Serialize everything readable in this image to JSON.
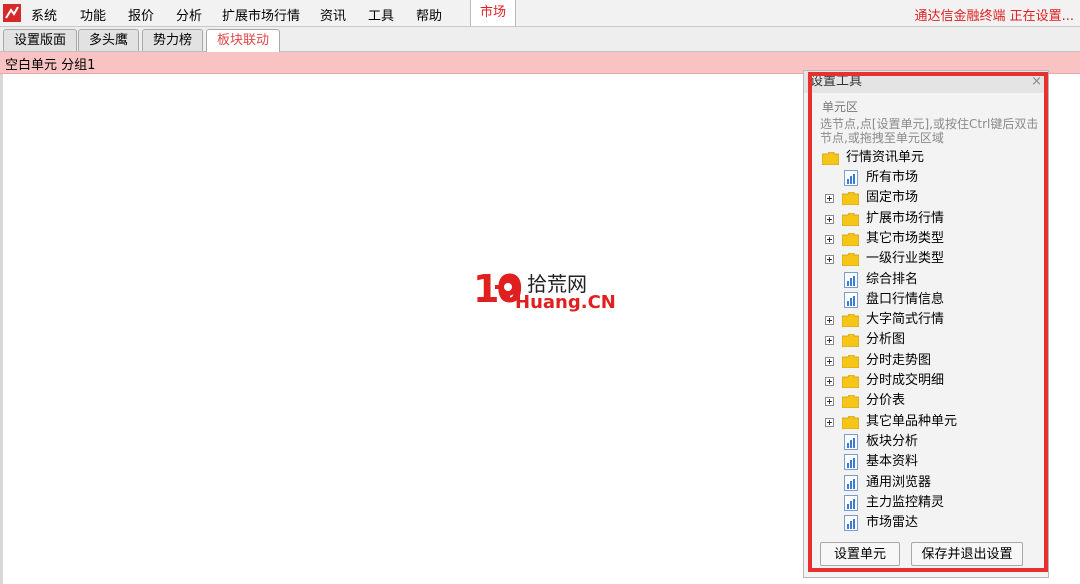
{
  "menubar": {
    "items": [
      "系统",
      "功能",
      "报价",
      "分析",
      "扩展市场行情",
      "资讯",
      "工具",
      "帮助"
    ],
    "market_tab": "市场",
    "status": "通达信金融终端  正在设置..."
  },
  "tabs": [
    "设置版面",
    "多头鹰",
    "势力榜",
    "板块联动"
  ],
  "group_strip": "空白单元 分组1",
  "watermark": {
    "num": "10",
    "cn": "拾荒网",
    "en": "Huang.CN"
  },
  "panel": {
    "title": "设置工具",
    "close": "×",
    "group_legend": "单元区",
    "hint": "选节点,点[设置单元],或按住Ctrl键后双击节点,或拖拽至单元区域",
    "root": "行情资讯单元",
    "items": [
      {
        "label": "所有市场",
        "type": "doc",
        "expandable": false
      },
      {
        "label": "固定市场",
        "type": "folder",
        "expandable": true
      },
      {
        "label": "扩展市场行情",
        "type": "folder",
        "expandable": true
      },
      {
        "label": "其它市场类型",
        "type": "folder",
        "expandable": true
      },
      {
        "label": "一级行业类型",
        "type": "folder",
        "expandable": true
      },
      {
        "label": "综合排名",
        "type": "doc",
        "expandable": false
      },
      {
        "label": "盘口行情信息",
        "type": "doc",
        "expandable": false
      },
      {
        "label": "大字简式行情",
        "type": "folder",
        "expandable": true
      },
      {
        "label": "分析图",
        "type": "folder",
        "expandable": true
      },
      {
        "label": "分时走势图",
        "type": "folder",
        "expandable": true
      },
      {
        "label": "分时成交明细",
        "type": "folder",
        "expandable": true
      },
      {
        "label": "分价表",
        "type": "folder",
        "expandable": true
      },
      {
        "label": "其它单品种单元",
        "type": "folder",
        "expandable": true
      },
      {
        "label": "板块分析",
        "type": "doc",
        "expandable": false
      },
      {
        "label": "基本资料",
        "type": "doc",
        "expandable": false
      },
      {
        "label": "通用浏览器",
        "type": "doc",
        "expandable": false
      },
      {
        "label": "主力监控精灵",
        "type": "doc",
        "expandable": false
      },
      {
        "label": "市场雷达",
        "type": "doc",
        "expandable": false
      }
    ],
    "buttons": {
      "set_unit": "设置单元",
      "save_exit": "保存并退出设置"
    }
  },
  "colors": {
    "accent": "#e02020",
    "strip": "#f9c3c3",
    "folder": "#f5c518",
    "doc": "#3a7bd5"
  }
}
